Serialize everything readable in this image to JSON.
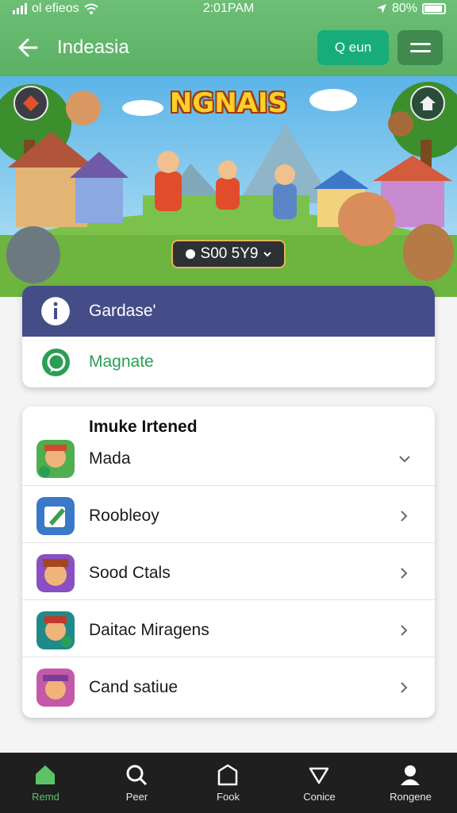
{
  "status_bar": {
    "carrier": "ol efieos",
    "time": "2:01PAM",
    "battery": "80%"
  },
  "app_bar": {
    "title": "Indeasia",
    "search_label": "Q eun"
  },
  "banner": {
    "game_title": "NGNAIS",
    "score": "S00 5Y9"
  },
  "options": [
    {
      "label": "Gardase'",
      "icon": "info-icon"
    },
    {
      "label": "Magnate",
      "icon": "chat-bubble-icon"
    }
  ],
  "list": {
    "heading": "Imuke Irtened",
    "items": [
      {
        "label": "Mada"
      },
      {
        "label": "Roobleoy"
      },
      {
        "label": "Sood Ctals"
      },
      {
        "label": "Daitac Miragens"
      },
      {
        "label": "Cand satiue"
      }
    ]
  },
  "bottom_nav": [
    {
      "label": "Remd",
      "icon": "home-icon",
      "active": true
    },
    {
      "label": "Peer",
      "icon": "search-icon"
    },
    {
      "label": "Fook",
      "icon": "shield-icon"
    },
    {
      "label": "Conice",
      "icon": "heart-icon"
    },
    {
      "label": "Rongene",
      "icon": "profile-icon"
    }
  ],
  "colors": {
    "header_green": "#5bb065",
    "search_button": "#16ad7a",
    "menu_button": "#3f8a4c",
    "option_primary": "#444d87",
    "option_secondary_text": "#2b9e56",
    "nav_background": "#1f1f1f",
    "nav_active": "#5cc267"
  }
}
